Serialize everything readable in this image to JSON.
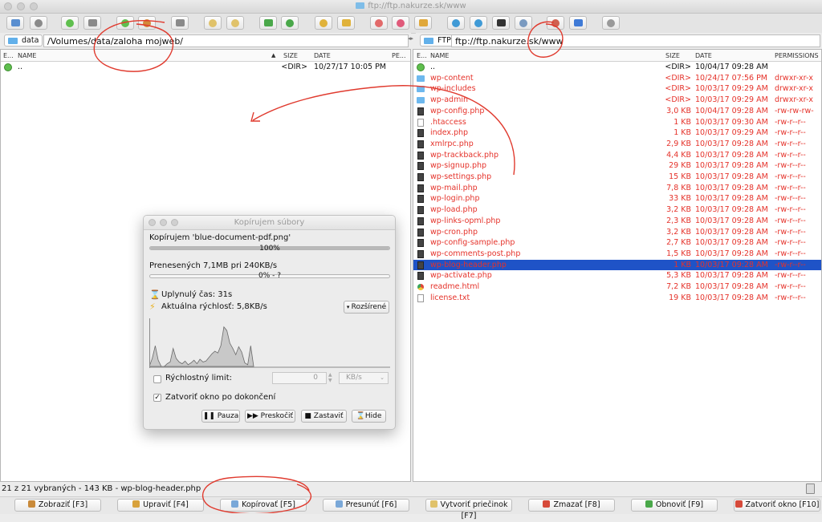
{
  "window": {
    "title": "ftp://ftp.nakurze.sk/www"
  },
  "toolbar": {
    "icons": [
      "new-tab-icon",
      "connect-icon",
      "go-icon",
      "stop-icon",
      "go-icon",
      "home-icon",
      "stop-icon",
      "new-folder-icon",
      "delete-folder-icon",
      "refresh-icon",
      "sync-icon",
      "archive-icon",
      "extract-icon",
      "bookmark-icon",
      "favorite-icon",
      "key-icon",
      "network-icon",
      "globe-icon",
      "terminal-icon",
      "screen-icon",
      "tools-icon",
      "info-icon",
      "settings-icon"
    ]
  },
  "left": {
    "drive": "data",
    "path": "/Volumes/data/zaloha mojweb/",
    "columns": {
      "ext": "E...",
      "name": "NAME",
      "size": "SIZE",
      "date": "DATE",
      "perm": "PE..."
    },
    "rows": [
      {
        "name": "..",
        "size": "<DIR>",
        "date": "10/27/17 10:05 PM"
      }
    ]
  },
  "right": {
    "drive": "FTP",
    "path": "ftp://ftp.nakurze.sk/www",
    "columns": {
      "ext": "E...",
      "name": "NAME",
      "size": "SIZE",
      "date": "DATE",
      "perm": "PERMISSIONS"
    },
    "rows": [
      {
        "icon": "up",
        "name": "..",
        "size": "<DIR>",
        "date": "10/04/17 09:28 AM",
        "perm": "",
        "style": "black"
      },
      {
        "icon": "folder",
        "name": "wp-content",
        "size": "<DIR>",
        "date": "10/24/17 07:56 PM",
        "perm": "drwxr-xr-x",
        "style": "red"
      },
      {
        "icon": "folder",
        "name": "wp-includes",
        "size": "<DIR>",
        "date": "10/03/17 09:29 AM",
        "perm": "drwxr-xr-x",
        "style": "red"
      },
      {
        "icon": "folder",
        "name": "wp-admin",
        "size": "<DIR>",
        "date": "10/03/17 09:29 AM",
        "perm": "drwxr-xr-x",
        "style": "red"
      },
      {
        "icon": "php",
        "name": "wp-config.php",
        "size": "3,0 KB",
        "date": "10/04/17 09:28 AM",
        "perm": "-rw-rw-rw-",
        "style": "red"
      },
      {
        "icon": "file",
        "name": ".htaccess",
        "size": "1 KB",
        "date": "10/03/17 09:30 AM",
        "perm": "-rw-r--r--",
        "style": "red"
      },
      {
        "icon": "php",
        "name": "index.php",
        "size": "1 KB",
        "date": "10/03/17 09:29 AM",
        "perm": "-rw-r--r--",
        "style": "red"
      },
      {
        "icon": "php",
        "name": "xmlrpc.php",
        "size": "2,9 KB",
        "date": "10/03/17 09:28 AM",
        "perm": "-rw-r--r--",
        "style": "red"
      },
      {
        "icon": "php",
        "name": "wp-trackback.php",
        "size": "4,4 KB",
        "date": "10/03/17 09:28 AM",
        "perm": "-rw-r--r--",
        "style": "red"
      },
      {
        "icon": "php",
        "name": "wp-signup.php",
        "size": "29 KB",
        "date": "10/03/17 09:28 AM",
        "perm": "-rw-r--r--",
        "style": "red"
      },
      {
        "icon": "php",
        "name": "wp-settings.php",
        "size": "15 KB",
        "date": "10/03/17 09:28 AM",
        "perm": "-rw-r--r--",
        "style": "red"
      },
      {
        "icon": "php",
        "name": "wp-mail.php",
        "size": "7,8 KB",
        "date": "10/03/17 09:28 AM",
        "perm": "-rw-r--r--",
        "style": "red"
      },
      {
        "icon": "php",
        "name": "wp-login.php",
        "size": "33 KB",
        "date": "10/03/17 09:28 AM",
        "perm": "-rw-r--r--",
        "style": "red"
      },
      {
        "icon": "php",
        "name": "wp-load.php",
        "size": "3,2 KB",
        "date": "10/03/17 09:28 AM",
        "perm": "-rw-r--r--",
        "style": "red"
      },
      {
        "icon": "php",
        "name": "wp-links-opml.php",
        "size": "2,3 KB",
        "date": "10/03/17 09:28 AM",
        "perm": "-rw-r--r--",
        "style": "red"
      },
      {
        "icon": "php",
        "name": "wp-cron.php",
        "size": "3,2 KB",
        "date": "10/03/17 09:28 AM",
        "perm": "-rw-r--r--",
        "style": "red"
      },
      {
        "icon": "php",
        "name": "wp-config-sample.php",
        "size": "2,7 KB",
        "date": "10/03/17 09:28 AM",
        "perm": "-rw-r--r--",
        "style": "red"
      },
      {
        "icon": "php",
        "name": "wp-comments-post.php",
        "size": "1,5 KB",
        "date": "10/03/17 09:28 AM",
        "perm": "-rw-r--r--",
        "style": "red"
      },
      {
        "icon": "php",
        "name": "wp-blog-header.php",
        "size": "1 KB",
        "date": "10/03/17 09:28 AM",
        "perm": "-rw-r--r--",
        "style": "selected"
      },
      {
        "icon": "php",
        "name": "wp-activate.php",
        "size": "5,3 KB",
        "date": "10/03/17 09:28 AM",
        "perm": "-rw-r--r--",
        "style": "red"
      },
      {
        "icon": "chrome",
        "name": "readme.html",
        "size": "7,2 KB",
        "date": "10/03/17 09:28 AM",
        "perm": "-rw-r--r--",
        "style": "red"
      },
      {
        "icon": "file",
        "name": "license.txt",
        "size": "19 KB",
        "date": "10/03/17 09:28 AM",
        "perm": "-rw-r--r--",
        "style": "red"
      }
    ]
  },
  "dialog": {
    "title": "Kopírujem súbory",
    "copying": "Kopírujem 'blue-document-pdf.png'",
    "file_progress_pct": 100,
    "file_progress_label": "100%",
    "transferred": "Prenesených 7,1MB pri 240KB/s",
    "total_progress_pct": 0,
    "total_progress_label": "0% - ?",
    "elapsed": "Uplynulý čas: 31s",
    "speed": "Aktuálna rýchlosť: 5,8KB/s",
    "advanced_label": "Rozšírené",
    "speed_limit_label": "Rýchlostný limit:",
    "speed_limit_value": "0",
    "speed_unit": "KB/s",
    "close_when_done_label": "Zatvoriť okno po dokončení",
    "close_when_done": true,
    "buttons": {
      "pause": "Pauza",
      "skip": "Preskočiť",
      "stop": "Zastaviť",
      "hide": "Hide"
    },
    "graph_values": [
      0,
      18,
      46,
      14,
      0,
      0,
      6,
      10,
      40,
      18,
      10,
      6,
      12,
      4,
      8,
      14,
      6,
      16,
      10,
      12,
      20,
      28,
      34,
      30,
      46,
      88,
      80,
      52,
      40,
      26,
      44,
      32,
      8,
      4,
      46,
      0
    ]
  },
  "status": {
    "text": "21 z 21 vybraných - 143 KB - wp-blog-header.php"
  },
  "fkeys": [
    {
      "label": "Zobraziť [F3]",
      "icon": "magnifier-icon",
      "color": "#c98a3a"
    },
    {
      "label": "Upraviť [F4]",
      "icon": "pencil-icon",
      "color": "#d8a23c"
    },
    {
      "label": "Kopírovať [F5]",
      "icon": "copy-icon",
      "color": "#7aa8d8"
    },
    {
      "label": "Presunúť [F6]",
      "icon": "move-icon",
      "color": "#7aa8d8"
    },
    {
      "label": "Vytvoriť priečinok [F7]",
      "icon": "folder-icon",
      "color": "#e0c26a"
    },
    {
      "label": "Zmazať [F8]",
      "icon": "delete-icon",
      "color": "#d64a3a"
    },
    {
      "label": "Obnoviť [F9]",
      "icon": "refresh-icon",
      "color": "#4aa84a"
    },
    {
      "label": "Zatvoriť okno [F10]",
      "icon": "close-window-icon",
      "color": "#d64a3a"
    }
  ],
  "colors": {
    "accent_selected": "#1f53c7",
    "remote_text": "#e5322a",
    "annotation": "#e03a2e"
  }
}
